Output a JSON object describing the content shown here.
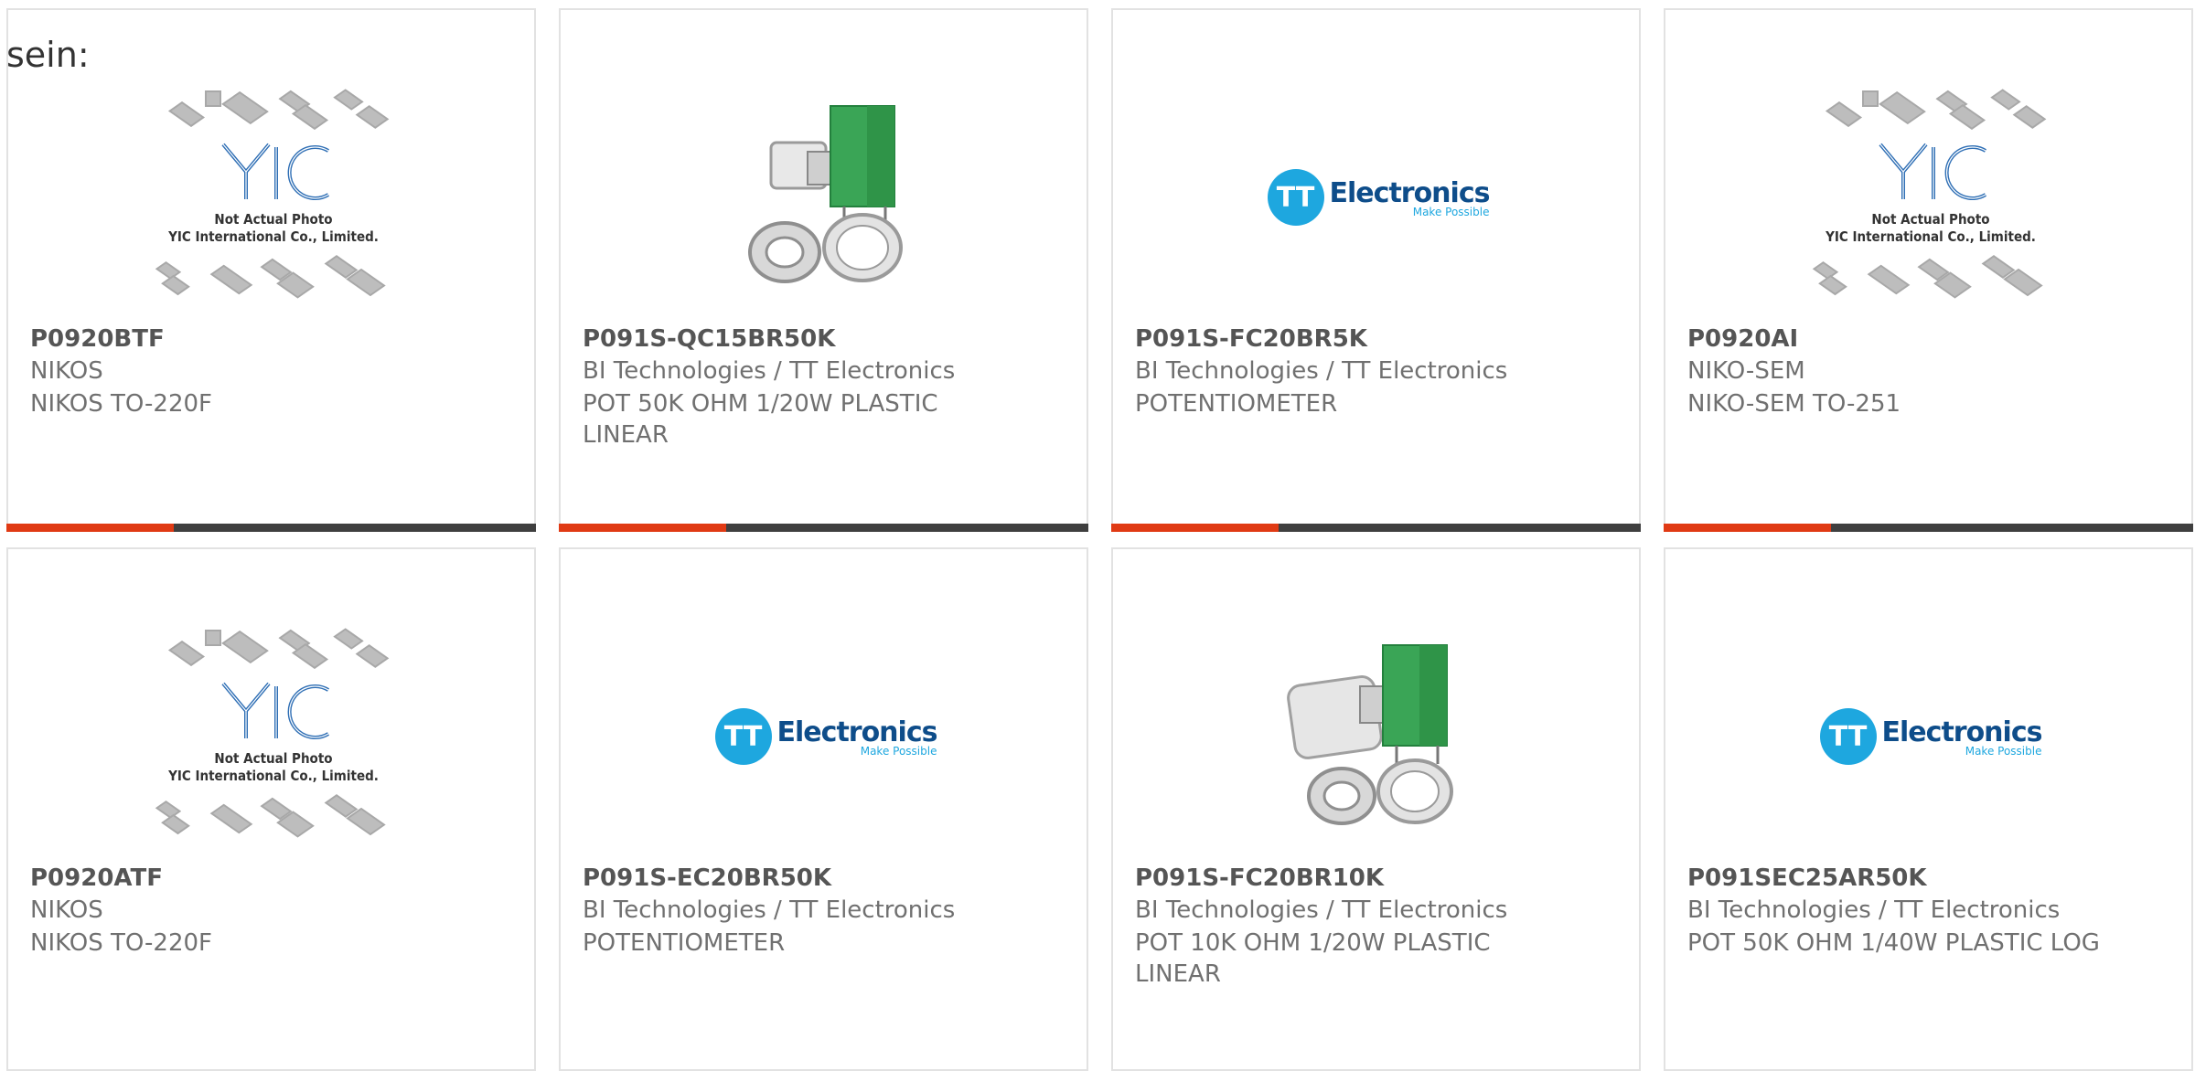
{
  "intro_text": "sein:",
  "accent_color": "#e03a14",
  "bar_color": "#3f3f3f",
  "placeholder": {
    "brand": "YIC",
    "line1": "Not Actual Photo",
    "line2": "YIC International Co., Limited."
  },
  "tt_logo": {
    "mark": "TT",
    "name": "Electronics",
    "tagline": "Make Possible"
  },
  "products": [
    {
      "part": "P0920BTF",
      "manufacturer": "NIKOS",
      "description": "NIKOS TO-220F",
      "image": "yic-placeholder"
    },
    {
      "part": "P091S-QC15BR50K",
      "manufacturer": "BI Technologies / TT Electronics",
      "description": "POT 50K OHM 1/20W PLASTIC LINEAR",
      "image": "potentiometer-short-shaft"
    },
    {
      "part": "P091S-FC20BR5K",
      "manufacturer": "BI Technologies / TT Electronics",
      "description": "POTENTIOMETER",
      "image": "tt-electronics-logo"
    },
    {
      "part": "P0920AI",
      "manufacturer": "NIKO-SEM",
      "description": "NIKO-SEM TO-251",
      "image": "yic-placeholder"
    },
    {
      "part": "P0920ATF",
      "manufacturer": "NIKOS",
      "description": "NIKOS TO-220F",
      "image": "yic-placeholder"
    },
    {
      "part": "P091S-EC20BR50K",
      "manufacturer": "BI Technologies / TT Electronics",
      "description": "POTENTIOMETER",
      "image": "tt-electronics-logo"
    },
    {
      "part": "P091S-FC20BR10K",
      "manufacturer": "BI Technologies / TT Electronics",
      "description": "POT 10K OHM 1/20W PLASTIC LINEAR",
      "image": "potentiometer-long-shaft"
    },
    {
      "part": "P091SEC25AR50K",
      "manufacturer": "BI Technologies / TT Electronics",
      "description": "POT 50K OHM 1/40W PLASTIC LOG",
      "image": "tt-electronics-logo"
    }
  ]
}
